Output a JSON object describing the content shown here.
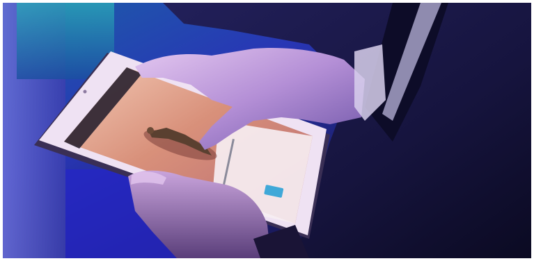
{
  "scene": {
    "tablet_screen_left": "",
    "tablet_screen_right": ""
  },
  "colors": {
    "background_blue": "#2a2fb8",
    "background_teal": "#1f8fa6",
    "suit_navy": "#141436",
    "skin_lit": "#c9a8e6",
    "tablet_bezel": "#f2e8f6",
    "screen_warm": "#c98a74"
  }
}
